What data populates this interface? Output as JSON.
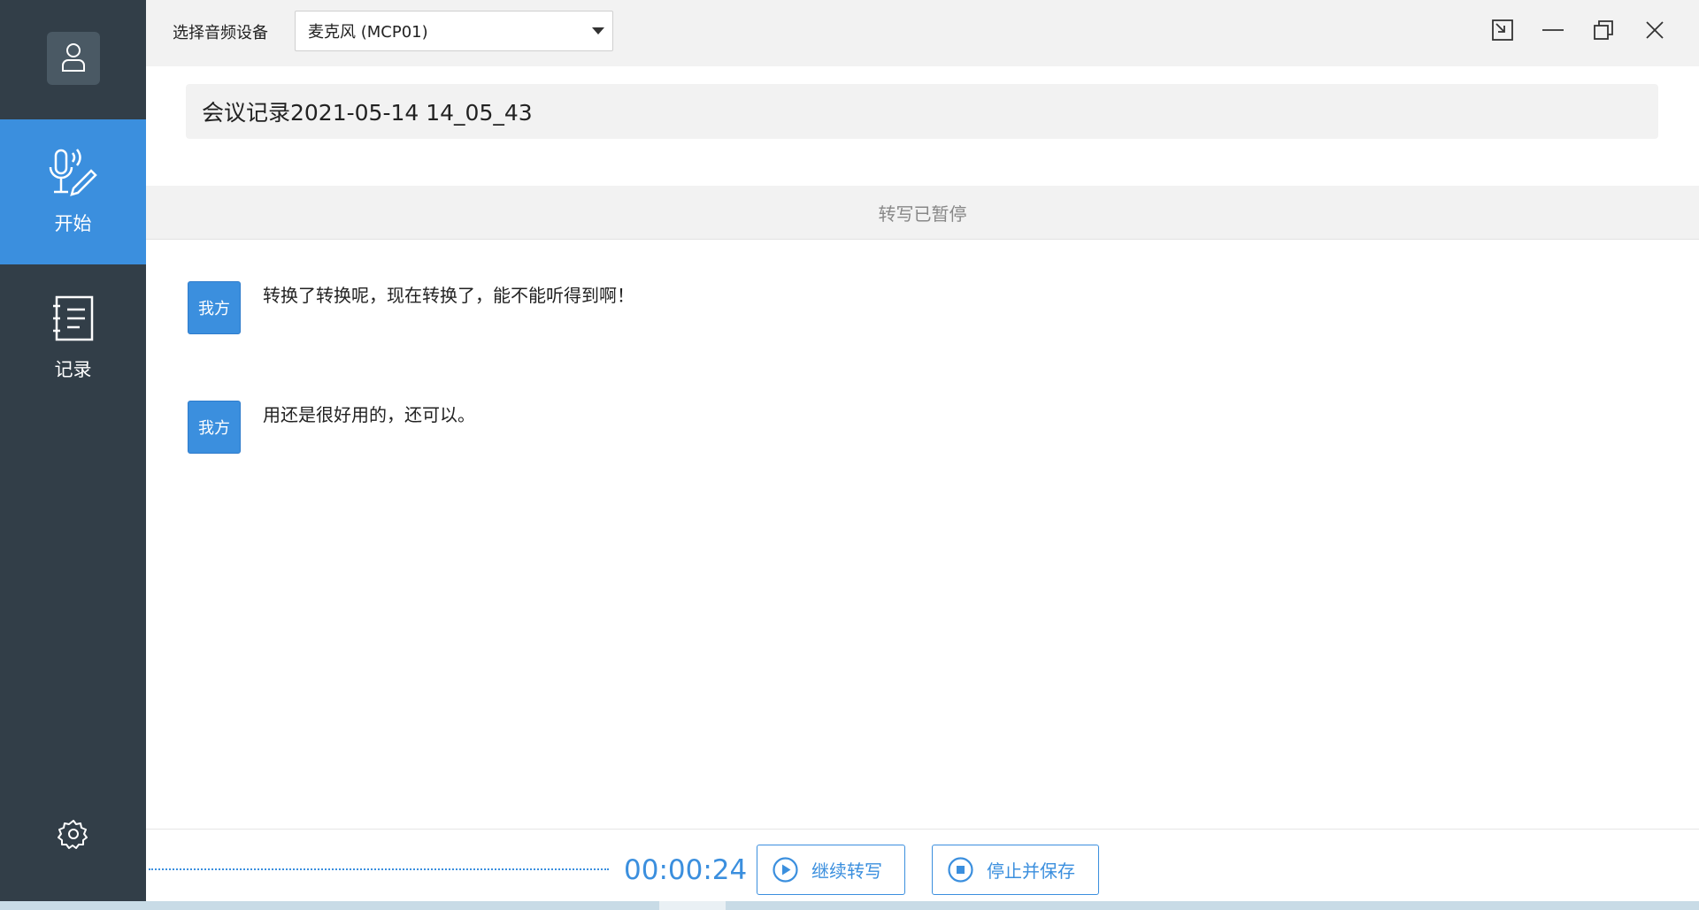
{
  "sidebar": {
    "avatar_icon": "user-icon",
    "items": [
      {
        "label": "开始",
        "icon": "microphone-pen-icon",
        "active": true
      },
      {
        "label": "记录",
        "icon": "notebook-icon",
        "active": false
      }
    ],
    "settings_icon": "gear-icon"
  },
  "topbar": {
    "device_label": "选择音频设备",
    "device_selected": "麦克风 (MCP01)",
    "window_controls": [
      "pin-window-icon",
      "minimize-icon",
      "restore-icon",
      "close-icon"
    ]
  },
  "meeting": {
    "title": "会议记录2021-05-14 14_05_43"
  },
  "status": {
    "text": "转写已暂停"
  },
  "messages": [
    {
      "speaker": "我方",
      "text": "转换了转换呢，现在转换了，能不能听得到啊！"
    },
    {
      "speaker": "我方",
      "text": "用还是很好用的，还可以。"
    }
  ],
  "footer": {
    "timer": "00:00:24",
    "resume_label": "继续转写",
    "stop_label": "停止并保存"
  },
  "colors": {
    "accent": "#3b8fde",
    "sidebar_bg": "#323e48",
    "topbar_bg": "#f2f2f2"
  }
}
